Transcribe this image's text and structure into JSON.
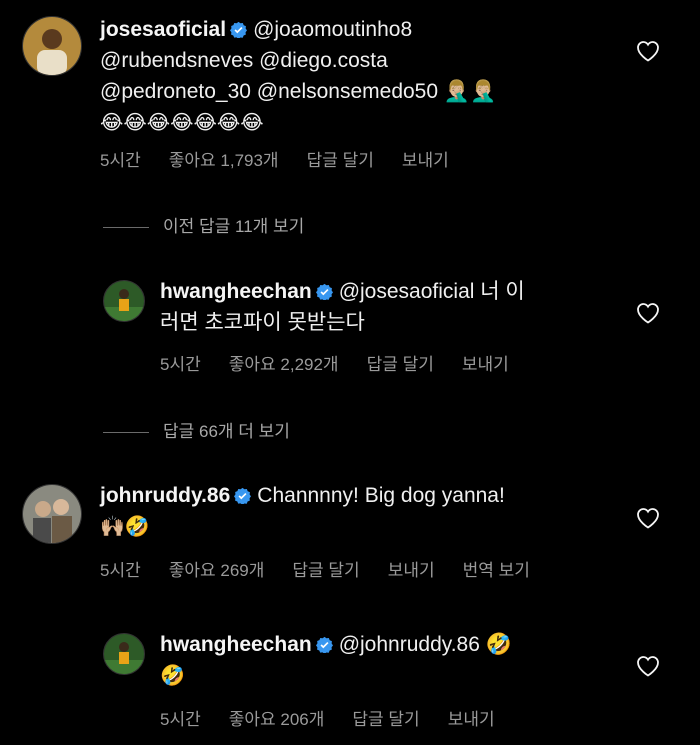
{
  "comments": [
    {
      "username": "josesaoficial",
      "text_lines": [
        "@joaomoutinho8",
        "@rubendsneves @diego.costa",
        "@pedroneto_30 @nelsonsemedo50 🤦🏼‍♂️🤦🏼‍♂️",
        "😂😂😂😂😂😂😂"
      ],
      "time": "5시간",
      "likes": "좋아요 1,793개",
      "reply": "답글 달기",
      "send": "보내기"
    },
    {
      "username": "hwangheechan",
      "text_lines": [
        "@josesaoficial 너 이",
        "러면 초코파이 못받는다"
      ],
      "time": "5시간",
      "likes": "좋아요 2,292개",
      "reply": "답글 달기",
      "send": "보내기"
    },
    {
      "username": "johnruddy.86",
      "text_lines": [
        "Channnny! Big dog yanna!",
        "🙌🏼🤣"
      ],
      "time": "5시간",
      "likes": "좋아요 269개",
      "reply": "답글 달기",
      "send": "보내기",
      "translate": "번역 보기"
    },
    {
      "username": "hwangheechan",
      "text_lines": [
        "@johnruddy.86 🤣",
        "🤣"
      ],
      "time": "5시간",
      "likes": "좋아요 206개",
      "reply": "답글 달기",
      "send": "보내기"
    }
  ],
  "view_previous": "이전 답글 11개 보기",
  "view_more": "답글 66개 더 보기",
  "icons": {
    "verified": "verified-badge-icon",
    "heart": "heart-outline-icon"
  },
  "colors": {
    "background": "#000000",
    "verified": "#3897f0",
    "meta_text": "#9a9a9a"
  }
}
